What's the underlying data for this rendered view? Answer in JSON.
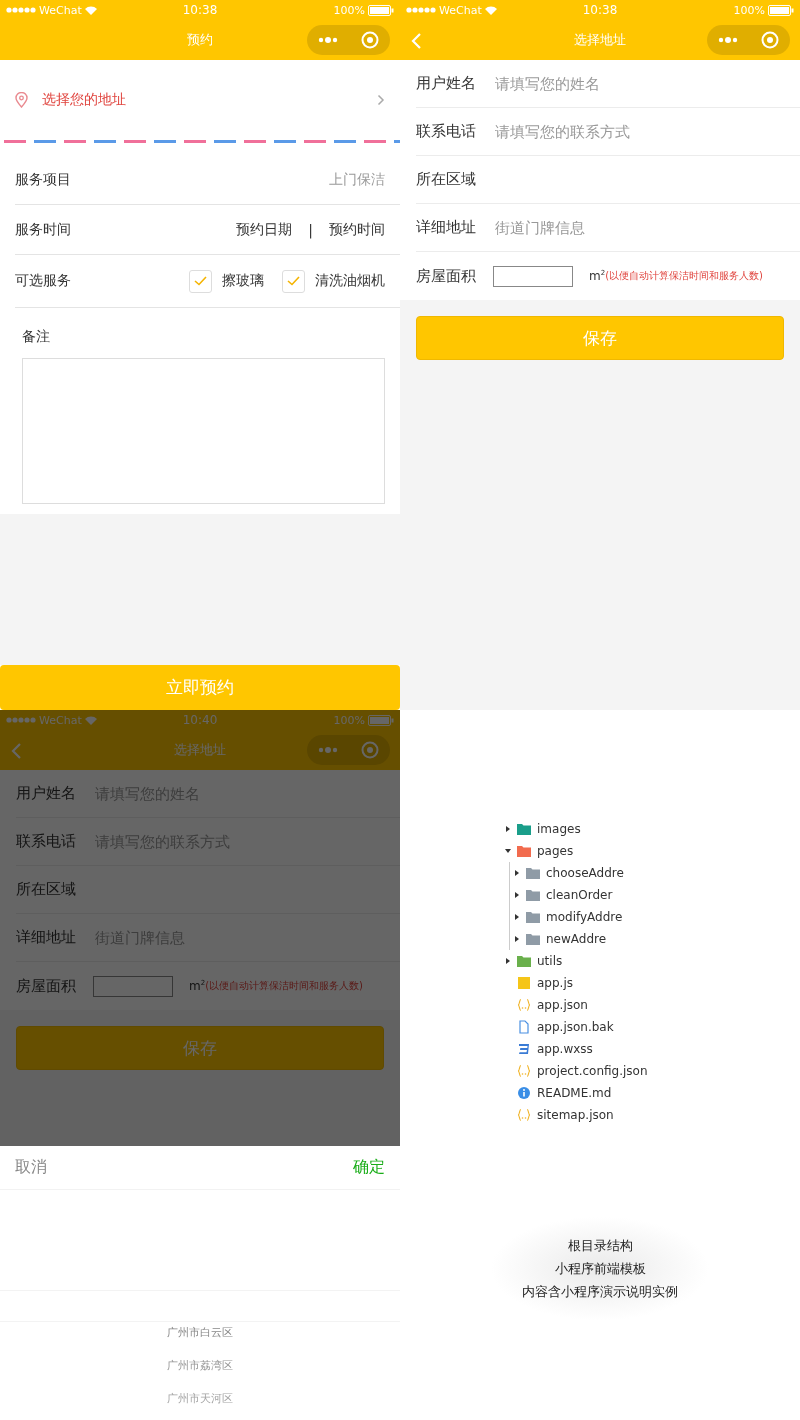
{
  "order_screen": {
    "status_bar": {
      "carrier": "WeChat",
      "time": "10:38",
      "battery": "100%"
    },
    "nav": {
      "title": "预约",
      "back": false
    },
    "address_prompt": "选择您的地址",
    "service_row": {
      "label": "服务项目",
      "value": "上门保洁"
    },
    "time_row": {
      "label": "服务时间",
      "date": "预约日期",
      "separator": "|",
      "time": "预约时间"
    },
    "options_row": {
      "label": "可选服务",
      "options": [
        {
          "label": "擦玻璃",
          "checked": true
        },
        {
          "label": "清洗油烟机",
          "checked": true
        }
      ]
    },
    "remarks": {
      "label": "备注"
    },
    "submit": "立即预约"
  },
  "address_screen": {
    "status_bar": {
      "carrier": "WeChat",
      "time": "10:38",
      "battery": "100%"
    },
    "nav": {
      "title": "选择地址",
      "back": true
    },
    "fields": [
      {
        "label": "用户姓名",
        "placeholder": "请填写您的姓名"
      },
      {
        "label": "联系电话",
        "placeholder": "请填写您的联系方式"
      },
      {
        "label": "所在区域"
      },
      {
        "label": "详细地址",
        "placeholder": "街道门牌信息"
      }
    ],
    "area": {
      "label": "房屋面积",
      "unit": "m$^{2}$",
      "note": "(以便自动计算保洁时间和服务人数)"
    },
    "save": "保存"
  },
  "picker_screen": {
    "status_bar": {
      "carrier": "WeChat",
      "time": "10:40",
      "battery": "100%"
    },
    "nav": {
      "title": "选择地址",
      "back": true
    },
    "fields": [
      {
        "label": "用户姓名",
        "placeholder": "请填写您的姓名"
      },
      {
        "label": "联系电话",
        "placeholder": "请填写您的联系方式"
      },
      {
        "label": "所在区域"
      },
      {
        "label": "详细地址",
        "placeholder": "街道门牌信息"
      }
    ],
    "area": {
      "label": "房屋面积",
      "unit": "m$^{2}$",
      "note": "(以便自动计算保洁时间和服务人数)"
    },
    "save": "保存",
    "picker": {
      "cancel": "取消",
      "confirm": "确定",
      "options": [
        "广州市白云区",
        "广州市荔湾区",
        "广州市天河区"
      ]
    }
  },
  "file_tree": {
    "items": [
      {
        "name": "images",
        "kind": "folder",
        "color": "#1a9e8a",
        "expanded": false
      },
      {
        "name": "pages",
        "kind": "folder",
        "color": "#f26b4e",
        "expanded": true,
        "children": [
          {
            "name": "chooseAddre",
            "kind": "folder",
            "color": "#8f9ba6",
            "expanded": false
          },
          {
            "name": "cleanOrder",
            "kind": "folder",
            "color": "#8f9ba6",
            "expanded": false
          },
          {
            "name": "modifyAddre",
            "kind": "folder",
            "color": "#8f9ba6",
            "expanded": false
          },
          {
            "name": "newAddre",
            "kind": "folder",
            "color": "#8f9ba6",
            "expanded": false
          }
        ]
      },
      {
        "name": "utils",
        "kind": "folder",
        "color": "#6ab04c",
        "expanded": false
      },
      {
        "name": "app.js",
        "kind": "js"
      },
      {
        "name": "app.json",
        "kind": "json"
      },
      {
        "name": "app.json.bak",
        "kind": "file"
      },
      {
        "name": "app.wxss",
        "kind": "css"
      },
      {
        "name": "project.config.json",
        "kind": "json"
      },
      {
        "name": "README.md",
        "kind": "info"
      },
      {
        "name": "sitemap.json",
        "kind": "json"
      }
    ]
  },
  "caption": [
    "根目录结构",
    "小程序前端模板",
    "内容含小程序演示说明实例"
  ]
}
